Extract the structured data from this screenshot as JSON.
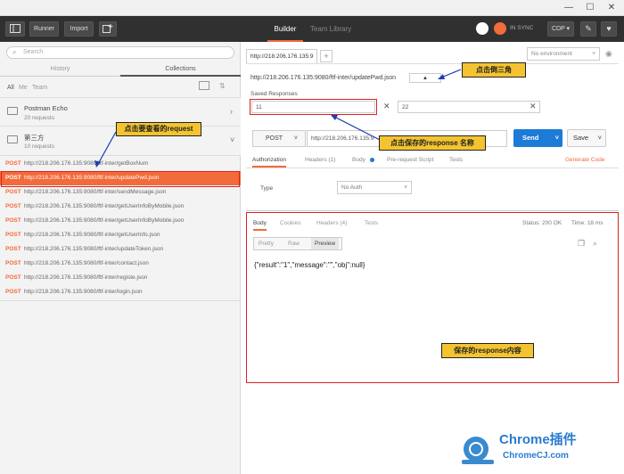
{
  "titlebar": {
    "minimize": "—",
    "maximize": "☐",
    "close": "✕"
  },
  "toolbar": {
    "runner": "Runner",
    "import": "Import",
    "tab_builder": "Builder",
    "tab_team": "Team Library",
    "sync": "IN SYNC",
    "cdp": "CDP"
  },
  "sidebar": {
    "search_placeholder": "Search",
    "tab_history": "History",
    "tab_collections": "Collections",
    "filters": [
      "All",
      "Me",
      "Team"
    ],
    "collections": [
      {
        "name": "Postman Echo",
        "count": "20 requests"
      },
      {
        "name": "第三方",
        "count": "10 requests"
      }
    ],
    "requests": [
      {
        "method": "POST",
        "url": "http://218.206.176.135:9080/ftf-inter/getBoxNum"
      },
      {
        "method": "POST",
        "url": "http://218.206.176.135:9080/ftf-inter/updatePwd.json"
      },
      {
        "method": "POST",
        "url": "http://218.206.176.135:9080/ftf-inter/sendMessage.json"
      },
      {
        "method": "POST",
        "url": "http://218.206.176.135:9080/ftf-inter/getUserInfoByMobile.json"
      },
      {
        "method": "POST",
        "url": "http://218.206.176.135:9080/ftf-inter/getUserInfoByMobile.json"
      },
      {
        "method": "POST",
        "url": "http://218.206.176.135:9080/ftf-inter/getUserInfo.json"
      },
      {
        "method": "POST",
        "url": "http://218.206.176.135:9080/ftf-inter/updateToken.json"
      },
      {
        "method": "POST",
        "url": "http://218.206.176.135:9080/ftf-inter/contact.json"
      },
      {
        "method": "POST",
        "url": "http://218.206.176.135:9080/ftf-inter/registe.json"
      },
      {
        "method": "POST",
        "url": "http://218.206.176.135:9080/ftf-inter/login.json"
      }
    ]
  },
  "main": {
    "request_tab": "http://218.206.176.135:9",
    "environment": "No environment",
    "breadcrumb": "http://218.206.176.135:9080/ftf-inter/updatePwd.json",
    "saved_label": "Saved Responses",
    "saved": [
      "11",
      "22"
    ],
    "method": "POST",
    "url": "http://218.206.176.135:9",
    "send": "Send",
    "save": "Save",
    "req_tabs": [
      "Authorization",
      "Headers (1)",
      "Body",
      "Pre-request Script",
      "Tests"
    ],
    "generate_code": "Generate Code",
    "type_label": "Type",
    "type_value": "No Auth",
    "resp_tabs": [
      "Body",
      "Cookies",
      "Headers (4)",
      "Tests"
    ],
    "status": "Status: 200 OK",
    "time": "Time: 18 ms",
    "view_modes": [
      "Pretty",
      "Raw",
      "Preview"
    ],
    "response_body": "{\"result\":\"1\",\"message\":\"\",\"obj\":null}"
  },
  "callouts": {
    "view_request": "点击要查看的request",
    "click_triangle": "点击倒三角",
    "click_saved": "点击保存的response 名称",
    "saved_content": "保存的response内容"
  },
  "watermark": {
    "title": "Chrome插件",
    "site": "ChromeCJ.com"
  }
}
